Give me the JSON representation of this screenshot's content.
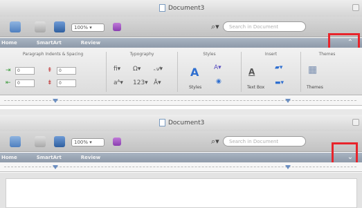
{
  "top_window": {
    "title": "Document3",
    "zoom": "100%",
    "search_placeholder": "Search in Document",
    "tabs": [
      "Home",
      "SmartArt",
      "Review"
    ],
    "collapse_glyph": "⌃",
    "groups": {
      "paragraph": "Paragraph Indents & Spacing",
      "typography": "Typography",
      "styles": "Styles",
      "insert": "Insert",
      "themes": "Themes"
    },
    "spinner_values": [
      "0",
      "0",
      "0",
      "0"
    ],
    "buttons": {
      "styles": "Styles",
      "text_box": "Text Box",
      "themes": "Themes"
    }
  },
  "bottom_window": {
    "title": "Document3",
    "zoom": "100%",
    "search_placeholder": "Search in Document",
    "tabs": [
      "Home",
      "SmartArt",
      "Review"
    ],
    "expand_glyph": "⌄"
  },
  "colors": {
    "highlight": "#e8242b",
    "tab_bar": "#9aa6b5"
  }
}
